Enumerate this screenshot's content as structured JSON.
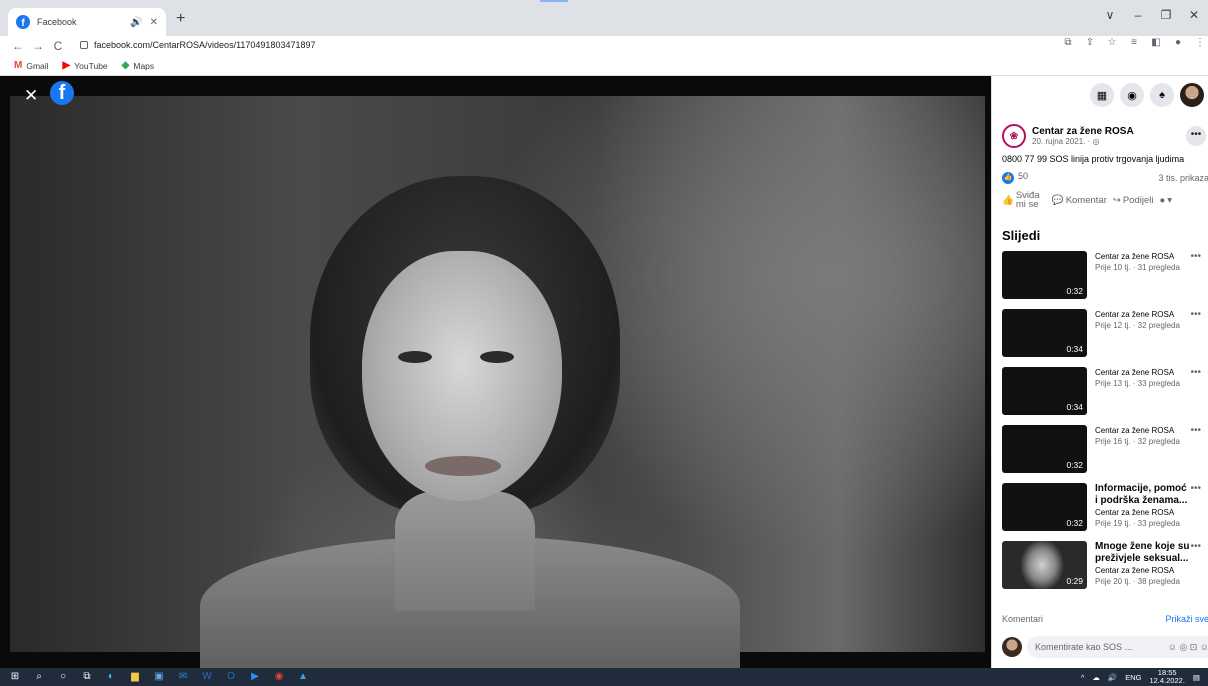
{
  "browser": {
    "tab_title": "Facebook",
    "tab_audio_icon": "speaker-icon",
    "new_tab": "+",
    "url": "facebook.com/CentarROSA/videos/1170491803471897",
    "nav": {
      "back": "←",
      "forward": "→",
      "reload": "C"
    },
    "window_controls": {
      "collapse": "∨",
      "minimize": "–",
      "restore": "❐",
      "close": "✕"
    },
    "bookmarks": [
      {
        "label": "Gmail",
        "icon": "M",
        "color": "#ea4335"
      },
      {
        "label": "YouTube",
        "icon": "▶",
        "color": "#ff0000"
      },
      {
        "label": "Maps",
        "icon": "◆",
        "color": "#34a853"
      }
    ]
  },
  "video": {
    "close": "✕",
    "logo": "f"
  },
  "panel": {
    "page_name": "Centar za žene ROSA",
    "date": "20. rujna 2021. · ◎",
    "description": "0800 77 99 SOS linija protiv trgovanja ljudima",
    "likes": "50",
    "views": "3 tis. prikaza",
    "actions": {
      "like": "Sviđa mi se",
      "comment": "Komentar",
      "share": "Podijeli"
    },
    "section_title": "Slijedi",
    "videos": [
      {
        "title": "",
        "channel": "Centar za žene ROSA",
        "meta": "Prije 10 tj. · 31 pregleda",
        "duration": "0:32"
      },
      {
        "title": "",
        "channel": "Centar za žene ROSA",
        "meta": "Prije 12 tj. · 32 pregleda",
        "duration": "0:34"
      },
      {
        "title": "",
        "channel": "Centar za žene ROSA",
        "meta": "Prije 13 tj. · 33 pregleda",
        "duration": "0:34"
      },
      {
        "title": "",
        "channel": "Centar za žene ROSA",
        "meta": "Prije 16 tj. · 32 pregleda",
        "duration": "0:32"
      },
      {
        "title": "Informacije, pomoć i podrška ženama...",
        "channel": "Centar za žene ROSA",
        "meta": "Prije 19 tj. · 33 pregleda",
        "duration": "0:32"
      },
      {
        "title": "Mnoge žene koje su preživjele seksual...",
        "channel": "Centar za žene ROSA",
        "meta": "Prije 20 tj. · 38 pregleda",
        "duration": "0:29"
      }
    ],
    "comments_label": "Komentari",
    "show_all": "Prikaži sve",
    "comment_placeholder": "Komentirate kao SOS ..."
  },
  "taskbar": {
    "lang": "ENG",
    "time": "18:55",
    "date": "12.4.2022."
  },
  "colors": {
    "facebook_blue": "#1877f2",
    "rosa_accent": "#b0125b",
    "taskbar": "#202c3c"
  }
}
